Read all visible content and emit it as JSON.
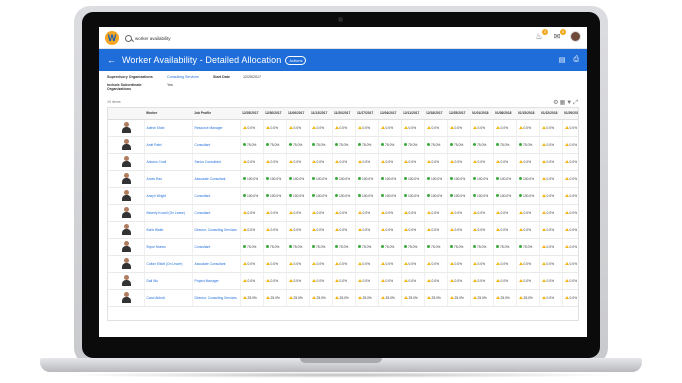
{
  "app": {
    "search_text": "worker availability",
    "notifications_badge": "3",
    "inbox_badge": "5",
    "accent_color": "#1f6dd8"
  },
  "page": {
    "title": "Worker Availability - Detailed Allocation",
    "actions_label": "Actions"
  },
  "params": {
    "org_label": "Supervisory Organizations",
    "org_value": "Consulting Services",
    "start_label": "Start Date",
    "start_value": "12/25/2017",
    "subord_label": "Include Subordinate Organizations",
    "subord_value": "Yes"
  },
  "grid": {
    "items_label": "19 items",
    "headers": [
      "",
      "Worker",
      "Job Profile",
      "12/25/2017",
      "12/30/2017",
      "11/06/2017",
      "11/13/2017",
      "11/20/2017",
      "11/27/2017",
      "12/04/2017",
      "12/11/2017",
      "12/18/2017",
      "12/25/2017",
      "01/01/2018",
      "01/08/2018",
      "01/15/2018",
      "01/22/2018",
      "01/29/2018"
    ],
    "rows": [
      {
        "worker": "Adesh Shah",
        "job": "Resource Manager",
        "status": "warn",
        "value": "0.0%",
        "last": "0.0%"
      },
      {
        "worker": "Amit Patel",
        "job": "Consultant",
        "status": "ok",
        "value": "75.0%",
        "last": "0.0%"
      },
      {
        "worker": "Antonio Conti",
        "job": "Senior Consultant",
        "status": "warn",
        "value": "0.0%",
        "last": "0.0%"
      },
      {
        "worker": "Arnav Rao",
        "job": "Associate Consultant",
        "status": "ok",
        "value": "100.0%",
        "last": "0.0%"
      },
      {
        "worker": "Arwyn Wright",
        "job": "Consultant",
        "status": "ok",
        "value": "100.0%",
        "last": "0.0%"
      },
      {
        "worker": "Beverly Knoell (On Leave)",
        "job": "Consultant",
        "status": "warn",
        "value": "0.0%",
        "last": "0.0%"
      },
      {
        "worker": "Boris Wafer",
        "job": "Director, Consulting Services",
        "status": "warn",
        "value": "0.0%",
        "last": "0.0%"
      },
      {
        "worker": "Bryce Morton",
        "job": "Consultant",
        "status": "ok",
        "value": "75.0%",
        "last": "0.0%"
      },
      {
        "worker": "Colton Elliott (On Leave)",
        "job": "Associate Consultant",
        "status": "warn",
        "value": "0.0%",
        "last": "0.0%"
      },
      {
        "worker": "Dali Wu",
        "job": "Project Manager",
        "status": "warn",
        "value": "0.0%",
        "last": "0.0%"
      },
      {
        "worker": "Carol Abbott",
        "job": "Director, Consulting Services",
        "status": "warn",
        "value": "25.0%",
        "last": "0.0%"
      }
    ]
  }
}
